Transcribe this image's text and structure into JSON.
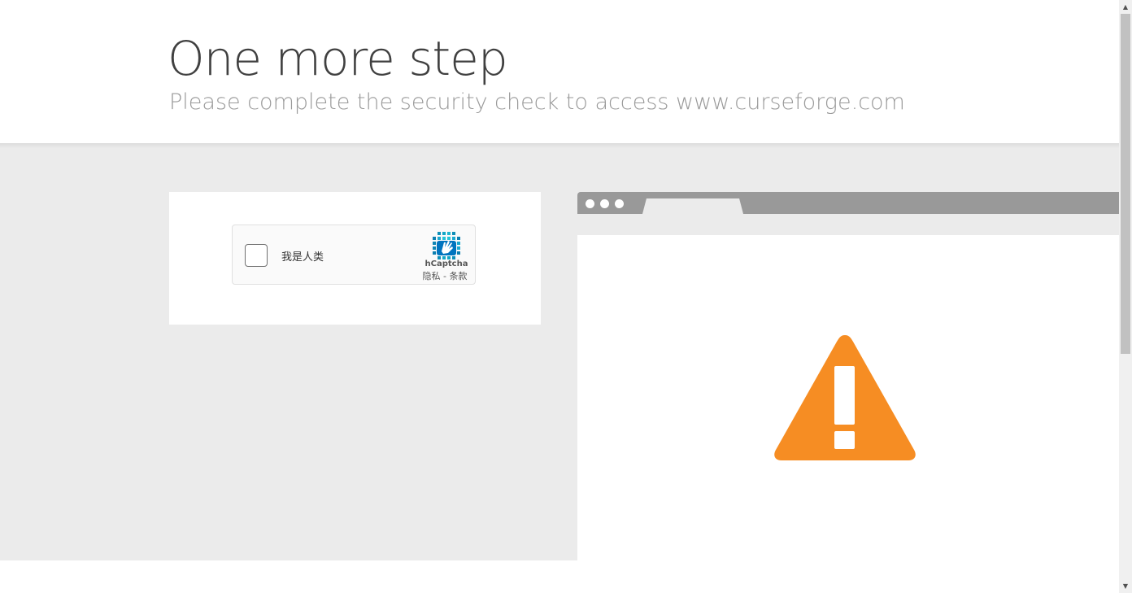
{
  "header": {
    "title": "One more step",
    "subtitle": "Please complete the security check to access www.curseforge.com"
  },
  "captcha": {
    "checkbox_label": "我是人类",
    "brand": "hCaptcha",
    "privacy_label": "隐私",
    "separator": " - ",
    "terms_label": "条款",
    "checked": false
  },
  "browser_mock": {
    "icon": "warning-triangle-icon",
    "icon_color": "#f68d23"
  },
  "scrollbar": {
    "up_arrow": "▲",
    "down_arrow": "▼"
  },
  "colors": {
    "header_bg": "#ffffff",
    "band_bg": "#ebebeb",
    "title": "#404040",
    "subtitle": "#9a9a9a",
    "browser_bar": "#999999",
    "warning": "#f68d23"
  }
}
